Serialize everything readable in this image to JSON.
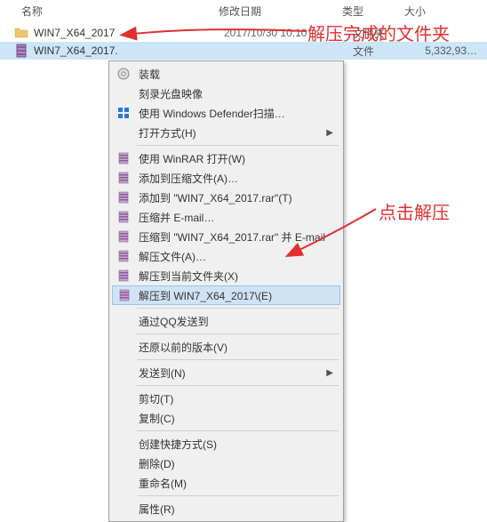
{
  "headers": {
    "name": "名称",
    "date": "修改日期",
    "type": "类型",
    "size": "大小"
  },
  "rows": [
    {
      "icon": "folder",
      "name": "WIN7_X64_2017",
      "date": "2017/10/30 10:10",
      "type": "文件夹",
      "size": ""
    },
    {
      "icon": "rar",
      "name": "WIN7_X64_2017.",
      "date": "",
      "type": "文件",
      "size": "5,332,93…"
    }
  ],
  "menu": {
    "items": [
      {
        "label": "装载",
        "icon": "disc"
      },
      {
        "label": "刻录光盘映像",
        "icon": ""
      },
      {
        "label": "使用 Windows Defender扫描…",
        "icon": "defender"
      },
      {
        "label": "打开方式(H)",
        "icon": "",
        "sub": true
      },
      {
        "sep": true
      },
      {
        "label": "使用 WinRAR 打开(W)",
        "icon": "winrar"
      },
      {
        "label": "添加到压缩文件(A)…",
        "icon": "winrar"
      },
      {
        "label": "添加到 \"WIN7_X64_2017.rar\"(T)",
        "icon": "winrar"
      },
      {
        "label": "压缩并 E-mail…",
        "icon": "winrar"
      },
      {
        "label": "压缩到 \"WIN7_X64_2017.rar\" 并 E-mail",
        "icon": "winrar"
      },
      {
        "label": "解压文件(A)…",
        "icon": "winrar"
      },
      {
        "label": "解压到当前文件夹(X)",
        "icon": "winrar"
      },
      {
        "label": "解压到 WIN7_X64_2017\\(E)",
        "icon": "winrar",
        "highlight": true
      },
      {
        "sep": true
      },
      {
        "label": "通过QQ发送到",
        "icon": ""
      },
      {
        "sep": true
      },
      {
        "label": "还原以前的版本(V)",
        "icon": ""
      },
      {
        "sep": true
      },
      {
        "label": "发送到(N)",
        "icon": "",
        "sub": true
      },
      {
        "sep": true
      },
      {
        "label": "剪切(T)",
        "icon": ""
      },
      {
        "label": "复制(C)",
        "icon": ""
      },
      {
        "sep": true
      },
      {
        "label": "创建快捷方式(S)",
        "icon": ""
      },
      {
        "label": "删除(D)",
        "icon": ""
      },
      {
        "label": "重命名(M)",
        "icon": ""
      },
      {
        "sep": true
      },
      {
        "label": "属性(R)",
        "icon": ""
      }
    ]
  },
  "annotations": {
    "a1": "解压完成的文件夹",
    "a2": "点击解压"
  }
}
